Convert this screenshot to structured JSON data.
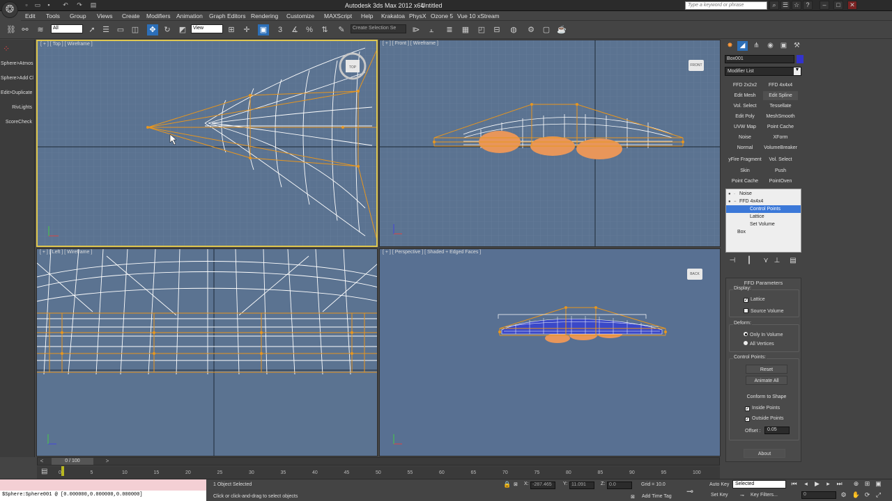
{
  "titlebar": {
    "app": "Autodesk 3ds Max 2012 x64",
    "file": "Untitled",
    "search_placeholder": "Type a keyword or phrase"
  },
  "menus": [
    "Edit",
    "Tools",
    "Group",
    "Views",
    "Create",
    "Modifiers",
    "Animation",
    "Graph Editors",
    "Rendering",
    "Customize",
    "MAXScript",
    "Help",
    "Krakatoa",
    "PhysX",
    "Ozone 5",
    "Vue 10 xStream"
  ],
  "toolbar": {
    "filter": "All",
    "ref_coord": "View",
    "named_sel": "Create Selection Se"
  },
  "leftbar": [
    "Sphere>Atmosphe",
    "Sphere>Add Clou",
    "Edit>Duplicate",
    "RivLights",
    "ScoreCheck"
  ],
  "viewports": {
    "top": {
      "label": "[ + ] [ Top ] [ Wireframe ]",
      "cube": "TOP"
    },
    "front": {
      "label": "[ + ] [ Front ] [ Wireframe ]",
      "cube": "FRONT"
    },
    "left": {
      "label": "[ + ] [ Left ] [ Wireframe ]"
    },
    "persp": {
      "label": "[ + ] [ Perspective ] [ Shaded + Edged Faces ]",
      "cube": "BACK"
    }
  },
  "panel": {
    "object_name": "Box001",
    "object_color": "#3333cc",
    "modifier_list": "Modifier List",
    "mod_buttons": [
      [
        "FFD 2x2x2",
        "FFD 4x4x4"
      ],
      [
        "Edit Mesh",
        "Edit Spline"
      ],
      [
        "Vol. Select",
        "Tessellate"
      ],
      [
        "Edit Poly",
        "MeshSmooth"
      ],
      [
        "UVW Map",
        "Point Cache"
      ],
      [
        "Noise",
        "XForm"
      ],
      [
        "Normal",
        "VolumeBreaker"
      ],
      [
        "yFire Fragment",
        "Vol. Select"
      ],
      [
        "Skin",
        "Push"
      ],
      [
        "Point Cache",
        "PointOven"
      ]
    ],
    "stack": [
      "Noise",
      "FFD 4x4x4",
      "Control Points",
      "Lattice",
      "Set Volume",
      "Box"
    ],
    "ffd": {
      "title": "FFD Parameters",
      "display": "Display:",
      "lattice": "Lattice",
      "source_volume": "Source Volume",
      "deform": "Deform:",
      "only_in_volume": "Only In Volume",
      "all_vertices": "All Vertices",
      "control_points": "Control Points:",
      "reset": "Reset",
      "animate_all": "Animate All",
      "conform": "Conform to Shape",
      "inside_points": "Inside Points",
      "outside_points": "Outside Points",
      "offset_label": "Offset :",
      "offset_value": "0.05",
      "about": "About"
    }
  },
  "timeslider": {
    "frame": "0 / 100",
    "ticks": [
      "0",
      "5",
      "10",
      "15",
      "20",
      "25",
      "30",
      "35",
      "40",
      "45",
      "50",
      "55",
      "60",
      "65",
      "70",
      "75",
      "80",
      "85",
      "90",
      "95",
      "100"
    ]
  },
  "status": {
    "maxscript1": "$Sphere:Sphere001 @ [0.000000,0.000000,0.000000]",
    "selected": "1 Object Selected",
    "prompt": "Click or click-and-drag to select objects",
    "x": "-287.465",
    "y": "11.091",
    "z": "0.0",
    "grid": "Grid = 10.0",
    "add_time_tag": "Add Time Tag",
    "auto_key": "Auto Key",
    "set_key": "Set Key",
    "key_mode": "Selected",
    "key_filters": "Key Filters...",
    "frame_field": "0"
  }
}
